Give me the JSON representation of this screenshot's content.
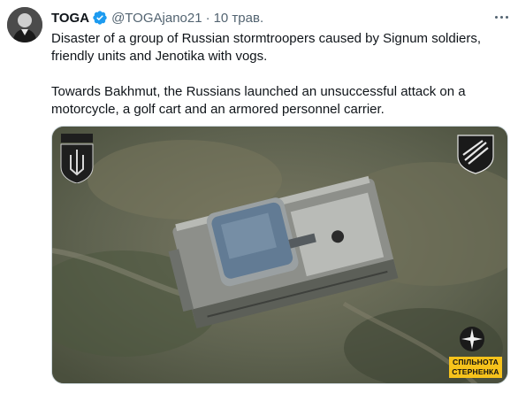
{
  "author": {
    "name": "TOGA",
    "handle": "@TOGAjano21",
    "separator": "·",
    "date": "10 трав."
  },
  "post": {
    "paragraph_1": "Disaster of a group of Russian stormtroopers caused by Signum soldiers, friendly units and Jenotika with vogs.",
    "paragraph_2": "Towards Bakhmut, the Russians launched an unsuccessful attack on a motorcycle, a golf cart and an armored personnel carrier."
  },
  "media": {
    "badge_line_1": "СПІЛЬНОТА",
    "badge_line_2": "СТЕРНЕНКА"
  },
  "icons": {
    "verified": "verified-badge-icon",
    "more": "more-icon"
  },
  "colors": {
    "verified": "#1d9bf0",
    "text": "#0f1419",
    "muted": "#536471",
    "badge": "#f6c21b"
  }
}
